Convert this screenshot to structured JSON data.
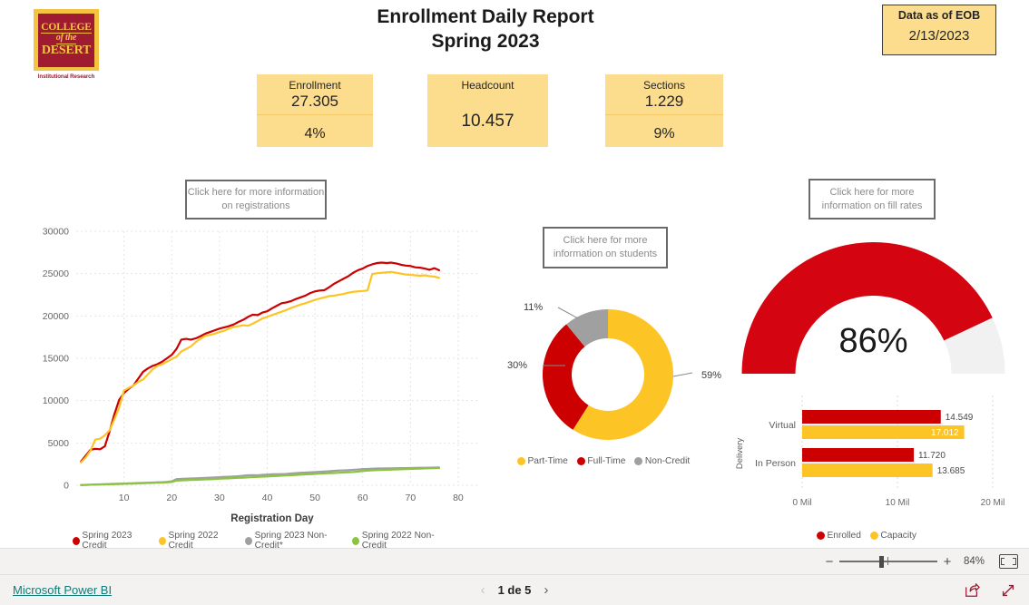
{
  "logo": {
    "line1": "COLLEGE",
    "line2": "of the",
    "line3": "DESERT",
    "subtitle": "Institutional Research"
  },
  "header": {
    "title_line1": "Enrollment Daily Report",
    "title_line2": "Spring 2023",
    "data_as_of_label": "Data as of EOB",
    "data_as_of_value": "2/13/2023"
  },
  "kpis": [
    {
      "label": "Enrollment",
      "value": "27.305",
      "change": "4%"
    },
    {
      "label": "Headcount",
      "value": "10.457",
      "change": ""
    },
    {
      "label": "Sections",
      "value": "1.229",
      "change": "9%"
    }
  ],
  "buttons": {
    "registrations": "Click here for more information on registrations",
    "students": "Click here for more information on students",
    "fill_rates": "Click here for more information on fill rates"
  },
  "colors": {
    "crimson": "#9e1b32",
    "red": "#d40511",
    "gold": "#fcc425",
    "gray": "#a0a0a0",
    "green": "#8bc53f",
    "card_bg": "#fcdd8e",
    "gauge_track": "#f1f1f1",
    "link": "#107c77"
  },
  "chart_data": [
    {
      "type": "line",
      "name": "registration-trend",
      "title": "",
      "xlabel": "Registration Day",
      "ylabel": "",
      "xlim": [
        0,
        84
      ],
      "ylim": [
        0,
        30000
      ],
      "xticks": [
        10,
        20,
        30,
        40,
        50,
        60,
        70,
        80
      ],
      "yticks": [
        0,
        5000,
        10000,
        15000,
        20000,
        25000,
        30000
      ],
      "grid": true,
      "legend_position": "bottom",
      "series": [
        {
          "name": "Spring 2023 Credit",
          "color": "#cc0000",
          "x": [
            1,
            2,
            3,
            4,
            5,
            6,
            7,
            8,
            9,
            10,
            11,
            12,
            13,
            14,
            15,
            16,
            17,
            18,
            19,
            20,
            21,
            22,
            23,
            24,
            25,
            26,
            27,
            28,
            29,
            30,
            31,
            32,
            33,
            34,
            35,
            36,
            37,
            38,
            39,
            40,
            41,
            42,
            43,
            44,
            45,
            46,
            47,
            48,
            49,
            50,
            51,
            52,
            53,
            54,
            55,
            56,
            57,
            58,
            59,
            60,
            61,
            62,
            63,
            64,
            65,
            66,
            67,
            68,
            69,
            70,
            71,
            72,
            73,
            74,
            75,
            76
          ],
          "values": [
            2800,
            3500,
            4200,
            4300,
            4250,
            4600,
            6400,
            8400,
            10100,
            10900,
            11400,
            11800,
            12600,
            13400,
            13800,
            14100,
            14300,
            14600,
            15000,
            15400,
            16100,
            17200,
            17300,
            17200,
            17350,
            17600,
            17900,
            18100,
            18300,
            18500,
            18650,
            18800,
            19000,
            19300,
            19550,
            19900,
            20150,
            20100,
            20400,
            20550,
            20900,
            21200,
            21500,
            21600,
            21750,
            22000,
            22200,
            22400,
            22700,
            22900,
            23000,
            23050,
            23400,
            23800,
            24100,
            24400,
            24700,
            25100,
            25400,
            25600,
            25900,
            26100,
            26250,
            26300,
            26250,
            26300,
            26200,
            26050,
            25950,
            25900,
            25750,
            25700,
            25600,
            25450,
            25650,
            25400
          ]
        },
        {
          "name": "Spring 2022 Credit",
          "color": "#fcc425",
          "x": [
            1,
            2,
            3,
            4,
            5,
            6,
            7,
            8,
            9,
            10,
            11,
            12,
            13,
            14,
            15,
            16,
            17,
            18,
            19,
            20,
            21,
            22,
            23,
            24,
            25,
            26,
            27,
            28,
            29,
            30,
            31,
            32,
            33,
            34,
            35,
            36,
            37,
            38,
            39,
            40,
            41,
            42,
            43,
            44,
            45,
            46,
            47,
            48,
            49,
            50,
            51,
            52,
            53,
            54,
            55,
            56,
            57,
            58,
            59,
            60,
            61,
            62,
            63,
            64,
            65,
            66,
            67,
            68,
            69,
            70,
            71,
            72,
            73,
            74,
            75,
            76
          ],
          "values": [
            2700,
            3300,
            4100,
            5400,
            5500,
            5900,
            6500,
            7800,
            9200,
            11200,
            11500,
            11800,
            12200,
            12500,
            13100,
            13700,
            14100,
            14300,
            14600,
            14900,
            15200,
            15800,
            16100,
            16400,
            16900,
            17300,
            17650,
            17750,
            17900,
            18100,
            18250,
            18500,
            18700,
            18800,
            18900,
            18850,
            19100,
            19400,
            19700,
            19900,
            20100,
            20300,
            20500,
            20700,
            20950,
            21150,
            21350,
            21500,
            21700,
            21900,
            22050,
            22200,
            22350,
            22400,
            22500,
            22600,
            22750,
            22850,
            22900,
            22950,
            23000,
            24950,
            25050,
            25100,
            25150,
            25200,
            25100,
            25000,
            24900,
            24850,
            24800,
            24750,
            24800,
            24700,
            24650,
            24500
          ]
        },
        {
          "name": "Spring 2023 Non-Credit*",
          "color": "#a0a0a0",
          "x": [
            1,
            2,
            3,
            4,
            5,
            6,
            7,
            8,
            9,
            10,
            11,
            12,
            13,
            14,
            15,
            16,
            17,
            18,
            19,
            20,
            21,
            22,
            23,
            24,
            25,
            26,
            27,
            28,
            29,
            30,
            31,
            32,
            33,
            34,
            35,
            36,
            37,
            38,
            39,
            40,
            41,
            42,
            43,
            44,
            45,
            46,
            47,
            48,
            49,
            50,
            51,
            52,
            53,
            54,
            55,
            56,
            57,
            58,
            59,
            60,
            61,
            62,
            63,
            64,
            65,
            66,
            67,
            68,
            69,
            70,
            71,
            72,
            73,
            74,
            75,
            76
          ],
          "values": [
            30,
            50,
            70,
            90,
            110,
            130,
            150,
            170,
            190,
            210,
            230,
            250,
            270,
            290,
            310,
            330,
            350,
            370,
            400,
            470,
            720,
            760,
            780,
            800,
            820,
            850,
            880,
            900,
            930,
            960,
            990,
            1010,
            1040,
            1070,
            1130,
            1180,
            1200,
            1180,
            1230,
            1260,
            1300,
            1320,
            1310,
            1340,
            1390,
            1440,
            1470,
            1500,
            1530,
            1560,
            1590,
            1620,
            1660,
            1700,
            1740,
            1760,
            1790,
            1830,
            1870,
            1900,
            1930,
            1960,
            1980,
            1990,
            1995,
            2000,
            2010,
            2020,
            2030,
            2040,
            2050,
            2060,
            2070,
            2080,
            2090,
            2100
          ]
        },
        {
          "name": "Spring 2022 Non-Credit",
          "color": "#8bc53f",
          "x": [
            1,
            2,
            3,
            4,
            5,
            6,
            7,
            8,
            9,
            10,
            11,
            12,
            13,
            14,
            15,
            16,
            17,
            18,
            19,
            20,
            21,
            22,
            23,
            24,
            25,
            26,
            27,
            28,
            29,
            30,
            31,
            32,
            33,
            34,
            35,
            36,
            37,
            38,
            39,
            40,
            41,
            42,
            43,
            44,
            45,
            46,
            47,
            48,
            49,
            50,
            51,
            52,
            53,
            54,
            55,
            56,
            57,
            58,
            59,
            60,
            61,
            62,
            63,
            64,
            65,
            66,
            67,
            68,
            69,
            70,
            71,
            72,
            73,
            74,
            75,
            76
          ],
          "values": [
            20,
            40,
            60,
            75,
            90,
            105,
            120,
            135,
            150,
            165,
            180,
            200,
            220,
            240,
            260,
            280,
            300,
            320,
            345,
            380,
            550,
            580,
            600,
            620,
            640,
            670,
            690,
            710,
            740,
            770,
            800,
            820,
            850,
            880,
            900,
            930,
            960,
            990,
            1010,
            1040,
            1070,
            1100,
            1130,
            1160,
            1190,
            1220,
            1250,
            1280,
            1310,
            1340,
            1370,
            1400,
            1430,
            1450,
            1480,
            1510,
            1540,
            1570,
            1620,
            1680,
            1720,
            1760,
            1790,
            1810,
            1830,
            1850,
            1870,
            1890,
            1910,
            1930,
            1950,
            1970,
            1990,
            2005,
            2020,
            2030
          ]
        }
      ]
    },
    {
      "type": "pie",
      "name": "student-type-donut",
      "title": "",
      "labels": [
        "Part-Time",
        "Full-Time",
        "Non-Credit"
      ],
      "values": [
        59,
        30,
        11
      ],
      "display_labels": [
        "59%",
        "30%",
        "11%"
      ],
      "colors": [
        "#fcc425",
        "#cc0000",
        "#a0a0a0"
      ],
      "legend_position": "bottom",
      "donut": true
    },
    {
      "type": "gauge",
      "name": "fill-rate-gauge",
      "value": 86,
      "display_value": "86%",
      "min": 0,
      "max": 100,
      "fill_color": "#d40511",
      "track_color": "#f1f1f1"
    },
    {
      "type": "bar",
      "name": "delivery-enrollment-bar",
      "orientation": "horizontal",
      "ylabel": "Delivery",
      "xlabel": "",
      "categories": [
        "Virtual",
        "In Person"
      ],
      "xticks": [
        "0 Mil",
        "10 Mil",
        "20 Mil"
      ],
      "xlim": [
        0,
        20
      ],
      "grid": true,
      "legend_position": "bottom",
      "series": [
        {
          "name": "Enrolled",
          "color": "#cc0000",
          "values": [
            14.549,
            11.72
          ],
          "display_values": [
            "14.549",
            "11.720"
          ]
        },
        {
          "name": "Capacity",
          "color": "#fcc425",
          "values": [
            17.012,
            13.685
          ],
          "display_values": [
            "17.012",
            "13.685"
          ]
        }
      ]
    }
  ],
  "statusbar": {
    "powerbi_link": "Microsoft Power BI",
    "page_label": "1 de 5",
    "zoom_pct": "84%",
    "zoom_minus": "−",
    "zoom_plus": "+",
    "prev_chevron": "‹",
    "next_chevron": "›"
  }
}
